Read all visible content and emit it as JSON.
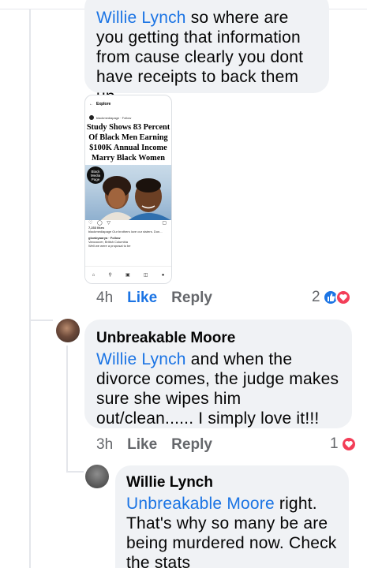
{
  "comments": [
    {
      "author": "",
      "mention": "Willie Lynch",
      "text": " so where are you getting that information from cause clearly you dont have receipts to back them up",
      "attachment": {
        "header": "Explore",
        "account": "blackmediapage · Follow",
        "title": "Study Shows 83 Percent Of Black Men Earning $100K Annual Income Marry Black Women",
        "badge": "Black Media Page",
        "likes": "7,233 likes",
        "caption": "blackmediapage Our brothers love our sisters. Don...",
        "commenter": "glowbyaarya · Follow",
        "location": "Vancouver, British Columbia",
        "snippet": "Well we were a proposal to be"
      },
      "time": "4h",
      "like_label": "Like",
      "reply_label": "Reply",
      "reaction_count": "2",
      "reactions": [
        "like-icon",
        "love-icon"
      ]
    },
    {
      "author": "Unbreakable Moore",
      "mention": "Willie Lynch",
      "text": " and when the divorce comes, the judge makes sure she wipes him out/clean...... I simply love it!!!",
      "time": "3h",
      "like_label": "Like",
      "reply_label": "Reply",
      "reaction_count": "1",
      "reactions": [
        "love-icon"
      ]
    },
    {
      "author": "Willie Lynch",
      "mention": "Unbreakable Moore",
      "text": " right. That's why so many be are being murdered now. Check the stats"
    }
  ],
  "colors": {
    "accent": "#1b74e4",
    "love": "#f33e58",
    "bubble": "#f0f2f5",
    "meta": "#65676b"
  }
}
